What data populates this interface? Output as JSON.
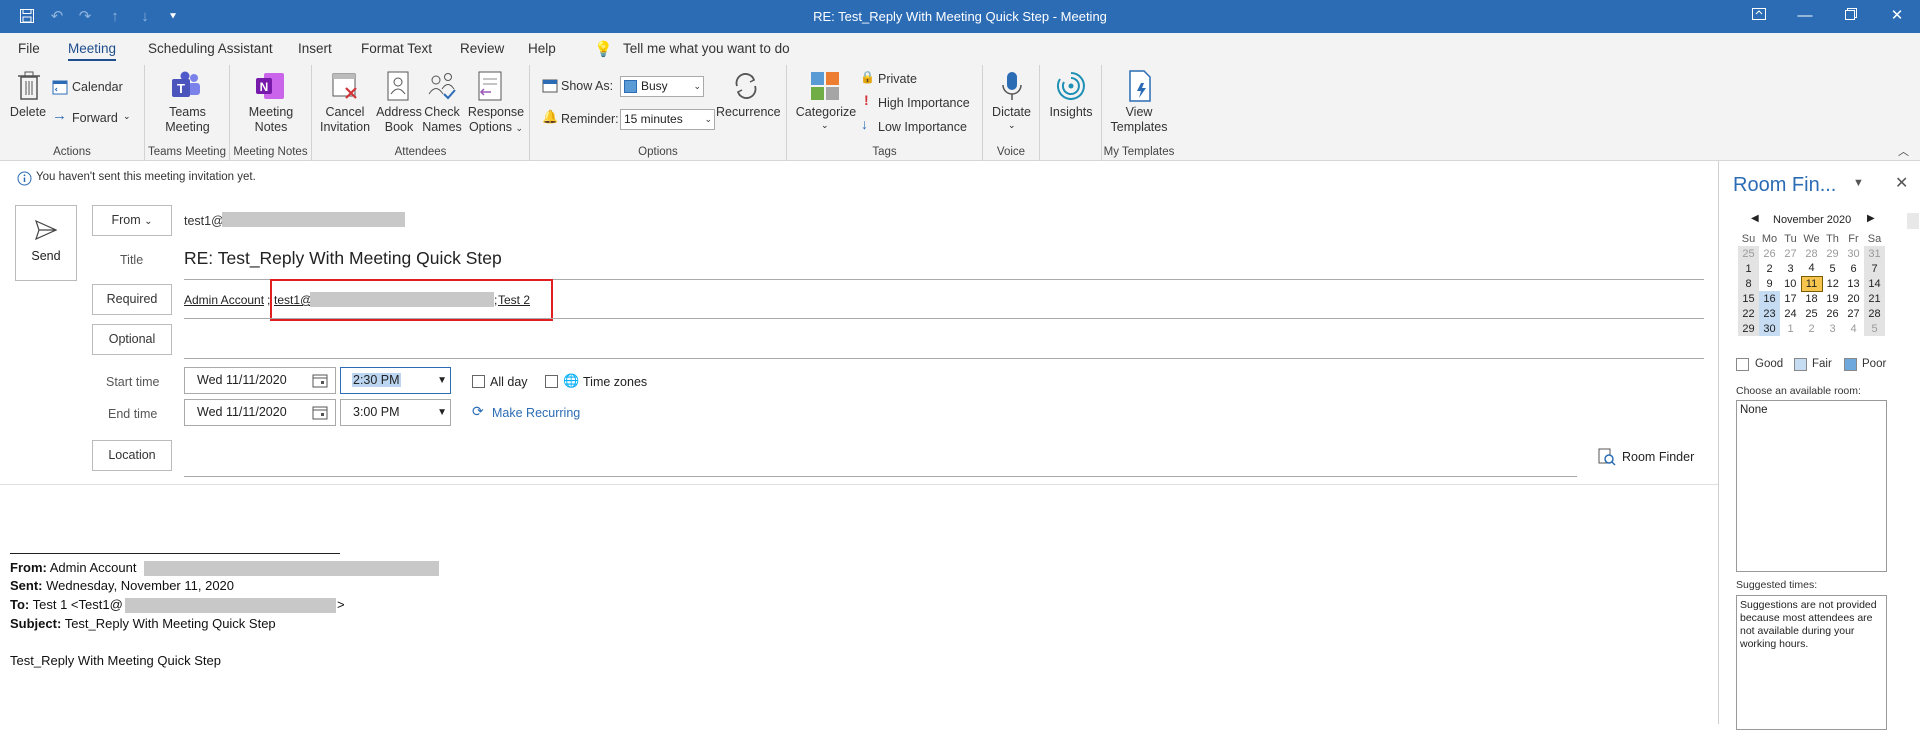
{
  "window": {
    "title": "RE: Test_Reply With Meeting Quick Step  -  Meeting"
  },
  "tabs": [
    "File",
    "Meeting",
    "Scheduling Assistant",
    "Insert",
    "Format Text",
    "Review",
    "Help"
  ],
  "tell_me": "Tell me what you want to do",
  "ribbon": {
    "actions": {
      "delete": "Delete",
      "calendar": "Calendar",
      "forward": "Forward",
      "label": "Actions"
    },
    "teams": {
      "btn1": "Teams",
      "btn2": "Meeting",
      "label": "Teams Meeting"
    },
    "notes": {
      "btn1": "Meeting",
      "btn2": "Notes",
      "label": "Meeting Notes"
    },
    "attendees": {
      "cancel1": "Cancel",
      "cancel2": "Invitation",
      "address1": "Address",
      "address2": "Book",
      "check1": "Check",
      "check2": "Names",
      "response1": "Response",
      "response2": "Options",
      "label": "Attendees"
    },
    "options": {
      "show_as_label": "Show As:",
      "show_as_value": "Busy",
      "reminder_label": "Reminder:",
      "reminder_value": "15 minutes",
      "recurrence": "Recurrence",
      "label": "Options"
    },
    "tags": {
      "categorize": "Categorize",
      "private": "Private",
      "high": "High Importance",
      "low": "Low Importance",
      "label": "Tags"
    },
    "voice": {
      "dictate": "Dictate",
      "label": "Voice"
    },
    "insights": {
      "label": "Insights"
    },
    "templates": {
      "btn1": "View",
      "btn2": "Templates",
      "label": "My Templates"
    }
  },
  "infobar": "You haven't sent this meeting invitation yet.",
  "form": {
    "send": "Send",
    "from_btn": "From",
    "from_value": "test1@",
    "title_label": "Title",
    "title_value": "RE: Test_Reply With Meeting Quick Step",
    "required_btn": "Required",
    "required_1": "Admin Account",
    "required_2": "test1@",
    "required_3": "Test 2",
    "optional_btn": "Optional",
    "start_label": "Start time",
    "start_date": "Wed 11/11/2020",
    "start_time": "2:30 PM",
    "end_label": "End time",
    "end_date": "Wed 11/11/2020",
    "end_time": "3:00 PM",
    "all_day": "All day",
    "time_zones": "Time zones",
    "make_recurring": "Make Recurring",
    "location_btn": "Location",
    "room_finder_btn": "Room Finder"
  },
  "body": {
    "from_label": "From:",
    "from_value": "Admin Account",
    "sent_label": "Sent:",
    "sent_value": "Wednesday, November 11, 2020",
    "to_label": "To:",
    "to_value": "Test 1 <Test1@",
    "to_close": ">",
    "subject_label": "Subject:",
    "subject_value": "Test_Reply With Meeting Quick Step",
    "text": "Test_Reply With Meeting Quick Step"
  },
  "room_finder": {
    "title": "Room Fin...",
    "month": "November 2020",
    "weekdays": [
      "Su",
      "Mo",
      "Tu",
      "We",
      "Th",
      "Fr",
      "Sa"
    ],
    "weeks": [
      [
        "25",
        "26",
        "27",
        "28",
        "29",
        "30",
        "31"
      ],
      [
        "1",
        "2",
        "3",
        "4",
        "5",
        "6",
        "7"
      ],
      [
        "8",
        "9",
        "10",
        "11",
        "12",
        "13",
        "14"
      ],
      [
        "15",
        "16",
        "17",
        "18",
        "19",
        "20",
        "21"
      ],
      [
        "22",
        "23",
        "24",
        "25",
        "26",
        "27",
        "28"
      ],
      [
        "29",
        "30",
        "1",
        "2",
        "3",
        "4",
        "5"
      ]
    ],
    "legend_good": "Good",
    "legend_fair": "Fair",
    "legend_poor": "Poor",
    "choose_label": "Choose an available room:",
    "choose_value": "None",
    "suggested_label": "Suggested times:",
    "suggested_text": "Suggestions are not provided because most attendees are not available during your working hours."
  },
  "colors": {
    "accent": "#2b6cb5",
    "highlight": "#e02020"
  }
}
